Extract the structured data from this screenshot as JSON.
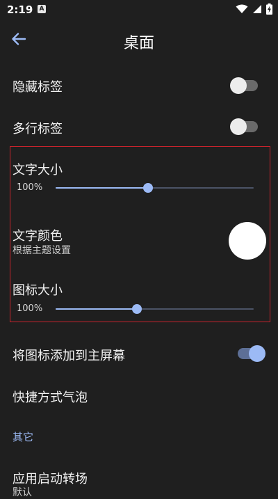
{
  "status_bar": {
    "time": "2:19",
    "notification_glyph": "A"
  },
  "app_bar": {
    "title": "桌面"
  },
  "rows": {
    "hide_labels": {
      "label": "隐藏标签",
      "enabled": false
    },
    "multiline_labels": {
      "label": "多行标签",
      "enabled": false
    },
    "text_size": {
      "label": "文字大小",
      "value_text": "100%",
      "slider_fraction": 0.465
    },
    "text_color": {
      "label": "文字颜色",
      "subtitle": "根据主题设置",
      "swatch_color": "#ffffff"
    },
    "icon_size": {
      "label": "图标大小",
      "value_text": "100%",
      "slider_fraction": 0.41
    },
    "add_to_home": {
      "label": "将图标添加到主屏幕",
      "enabled": true
    },
    "shortcut_bubble": {
      "label": "快捷方式气泡"
    }
  },
  "sections": {
    "other": {
      "header": "其它"
    },
    "app_launch": {
      "label": "应用启动转场",
      "subtitle": "默认"
    }
  },
  "colors": {
    "background": "#1f1f1f",
    "accent": "#9cbaf5",
    "highlight_border": "#c8232c"
  }
}
